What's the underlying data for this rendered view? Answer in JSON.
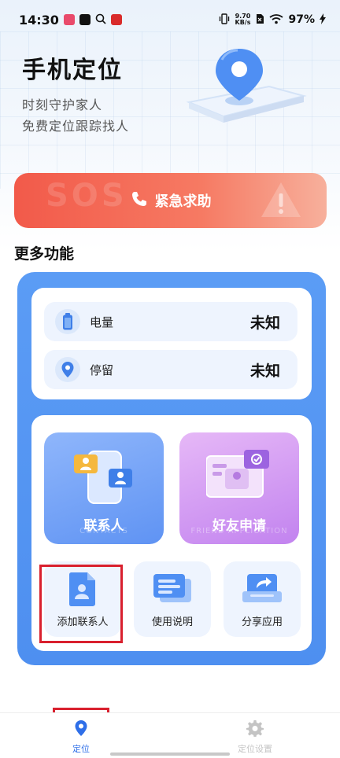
{
  "status_bar": {
    "time": "14:30",
    "net_speed_value": "9.70",
    "net_speed_unit": "KB/s",
    "battery": "97%"
  },
  "header": {
    "title": "手机定位",
    "subtitle_1": "时刻守护家人",
    "subtitle_2": "免费定位跟踪找人"
  },
  "sos": {
    "label": "紧急求助",
    "watermark": "SOS"
  },
  "more": {
    "title": "更多功能"
  },
  "info": {
    "battery_label": "电量",
    "battery_value": "未知",
    "stay_label": "停留",
    "stay_value": "未知"
  },
  "features": {
    "contacts_label": "联系人",
    "contacts_en": "CONTACTS",
    "friend_label": "好友申请",
    "friend_en": "FRIEND APPLICATION",
    "add_contact_label": "添加联系人",
    "instructions_label": "使用说明",
    "share_label": "分享应用"
  },
  "nav": {
    "locate_label": "定位",
    "settings_label": "定位设置"
  },
  "colors": {
    "accent_blue": "#4e8ff0",
    "sos_red": "#f25a4a",
    "highlight_red": "#d9202e",
    "nav_active": "#2f6fe8",
    "nav_inactive": "#c4c4c4"
  }
}
